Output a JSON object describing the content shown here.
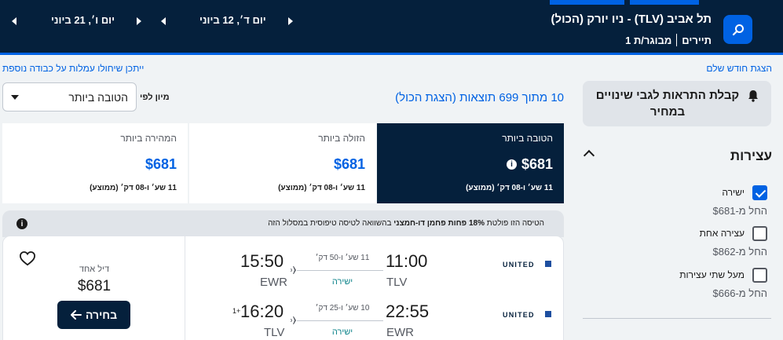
{
  "header": {
    "route": "תל אביב (TLV) - ניו יורק (הכול)",
    "passengers": "מבוגר/ת 1",
    "cabin": "תיירים",
    "date_depart": "יום ד׳, 12 ביוני",
    "date_return": "יום ו׳, 21 ביוני"
  },
  "links": {
    "full_month": "הצגת חודש שלם",
    "fees_note": "ייתכן שיחולו עמלות על כבודה נוספת"
  },
  "sidebar": {
    "alert_button": "קבלת התראות לגבי שינויים במחיר",
    "stops_title": "עצירות",
    "stops": [
      {
        "label": "ישירה",
        "price": "החל מ-$681",
        "checked": true
      },
      {
        "label": "עצירה אחת",
        "price": "החל מ-$862",
        "checked": false
      },
      {
        "label": "מעל שתי עצירות",
        "price": "החל מ-$666",
        "checked": false
      }
    ]
  },
  "results": {
    "count_text": "10 מתוך 699 תוצאות (הצגת הכול)",
    "sort_label": "מיון לפי",
    "sort_value": "הטובה ביותר"
  },
  "tabs": [
    {
      "label": "הטובה ביותר",
      "price": "$681",
      "duration": "11 שע׳ ו-08 דק׳ (ממוצע)",
      "active": true
    },
    {
      "label": "הזולה ביותר",
      "price": "$681",
      "duration": "11 שע׳ ו-08 דק׳ (ממוצע)",
      "active": false
    },
    {
      "label": "המהירה ביותר",
      "price": "$681",
      "duration": "11 שע׳ ו-08 דק׳ (ממוצע)",
      "active": false
    }
  ],
  "eco_banner": {
    "before": "הטיסה הזו פולטת ",
    "bold": "18% פחות פחמן דו-חמצני",
    "after": " בהשוואה לטיסה טיפוסית במסלול הזה"
  },
  "card": {
    "deal_label": "דיל אחד",
    "deal_price": "$681",
    "select_label": "בחירה",
    "legs": [
      {
        "airline": "UNITED",
        "dep_time": "11:00",
        "dep_code": "TLV",
        "arr_time": "15:50",
        "arr_code": "EWR",
        "duration": "11 שע׳ ו-50 דק׳",
        "stops": "ישירה",
        "day_offset": ""
      },
      {
        "airline": "UNITED",
        "dep_time": "22:55",
        "dep_code": "EWR",
        "arr_time": "16:20",
        "arr_code": "TLV",
        "duration": "10 שע׳ ו-25 דק׳",
        "stops": "ישירה",
        "day_offset": "1+"
      }
    ]
  },
  "colors": {
    "navy": "#05203c",
    "brand_blue": "#0062e3",
    "direct_teal": "#0c838a"
  },
  "icons": [
    "search-icon",
    "bell-icon",
    "chevron-up-icon",
    "info-icon",
    "heart-icon",
    "arrow-left-icon",
    "plane-icon",
    "caret-down-icon"
  ]
}
